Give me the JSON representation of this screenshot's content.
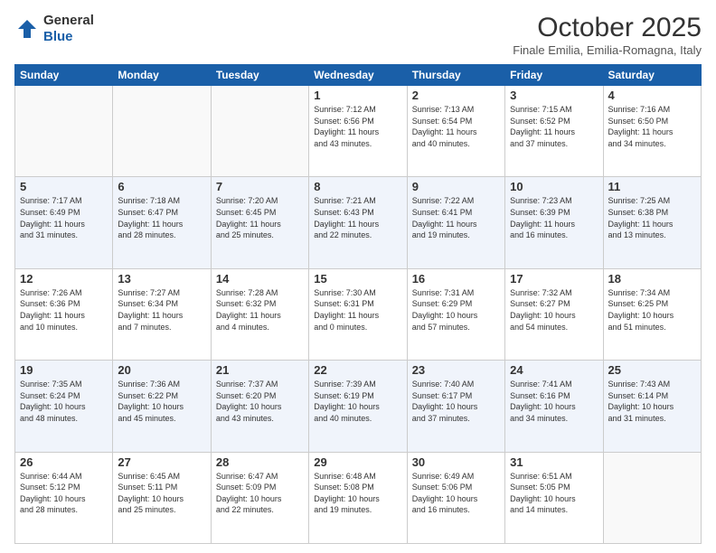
{
  "logo": {
    "general": "General",
    "blue": "Blue"
  },
  "header": {
    "title": "October 2025",
    "subtitle": "Finale Emilia, Emilia-Romagna, Italy"
  },
  "weekdays": [
    "Sunday",
    "Monday",
    "Tuesday",
    "Wednesday",
    "Thursday",
    "Friday",
    "Saturday"
  ],
  "weeks": [
    [
      {
        "day": "",
        "info": ""
      },
      {
        "day": "",
        "info": ""
      },
      {
        "day": "",
        "info": ""
      },
      {
        "day": "1",
        "info": "Sunrise: 7:12 AM\nSunset: 6:56 PM\nDaylight: 11 hours\nand 43 minutes."
      },
      {
        "day": "2",
        "info": "Sunrise: 7:13 AM\nSunset: 6:54 PM\nDaylight: 11 hours\nand 40 minutes."
      },
      {
        "day": "3",
        "info": "Sunrise: 7:15 AM\nSunset: 6:52 PM\nDaylight: 11 hours\nand 37 minutes."
      },
      {
        "day": "4",
        "info": "Sunrise: 7:16 AM\nSunset: 6:50 PM\nDaylight: 11 hours\nand 34 minutes."
      }
    ],
    [
      {
        "day": "5",
        "info": "Sunrise: 7:17 AM\nSunset: 6:49 PM\nDaylight: 11 hours\nand 31 minutes."
      },
      {
        "day": "6",
        "info": "Sunrise: 7:18 AM\nSunset: 6:47 PM\nDaylight: 11 hours\nand 28 minutes."
      },
      {
        "day": "7",
        "info": "Sunrise: 7:20 AM\nSunset: 6:45 PM\nDaylight: 11 hours\nand 25 minutes."
      },
      {
        "day": "8",
        "info": "Sunrise: 7:21 AM\nSunset: 6:43 PM\nDaylight: 11 hours\nand 22 minutes."
      },
      {
        "day": "9",
        "info": "Sunrise: 7:22 AM\nSunset: 6:41 PM\nDaylight: 11 hours\nand 19 minutes."
      },
      {
        "day": "10",
        "info": "Sunrise: 7:23 AM\nSunset: 6:39 PM\nDaylight: 11 hours\nand 16 minutes."
      },
      {
        "day": "11",
        "info": "Sunrise: 7:25 AM\nSunset: 6:38 PM\nDaylight: 11 hours\nand 13 minutes."
      }
    ],
    [
      {
        "day": "12",
        "info": "Sunrise: 7:26 AM\nSunset: 6:36 PM\nDaylight: 11 hours\nand 10 minutes."
      },
      {
        "day": "13",
        "info": "Sunrise: 7:27 AM\nSunset: 6:34 PM\nDaylight: 11 hours\nand 7 minutes."
      },
      {
        "day": "14",
        "info": "Sunrise: 7:28 AM\nSunset: 6:32 PM\nDaylight: 11 hours\nand 4 minutes."
      },
      {
        "day": "15",
        "info": "Sunrise: 7:30 AM\nSunset: 6:31 PM\nDaylight: 11 hours\nand 0 minutes."
      },
      {
        "day": "16",
        "info": "Sunrise: 7:31 AM\nSunset: 6:29 PM\nDaylight: 10 hours\nand 57 minutes."
      },
      {
        "day": "17",
        "info": "Sunrise: 7:32 AM\nSunset: 6:27 PM\nDaylight: 10 hours\nand 54 minutes."
      },
      {
        "day": "18",
        "info": "Sunrise: 7:34 AM\nSunset: 6:25 PM\nDaylight: 10 hours\nand 51 minutes."
      }
    ],
    [
      {
        "day": "19",
        "info": "Sunrise: 7:35 AM\nSunset: 6:24 PM\nDaylight: 10 hours\nand 48 minutes."
      },
      {
        "day": "20",
        "info": "Sunrise: 7:36 AM\nSunset: 6:22 PM\nDaylight: 10 hours\nand 45 minutes."
      },
      {
        "day": "21",
        "info": "Sunrise: 7:37 AM\nSunset: 6:20 PM\nDaylight: 10 hours\nand 43 minutes."
      },
      {
        "day": "22",
        "info": "Sunrise: 7:39 AM\nSunset: 6:19 PM\nDaylight: 10 hours\nand 40 minutes."
      },
      {
        "day": "23",
        "info": "Sunrise: 7:40 AM\nSunset: 6:17 PM\nDaylight: 10 hours\nand 37 minutes."
      },
      {
        "day": "24",
        "info": "Sunrise: 7:41 AM\nSunset: 6:16 PM\nDaylight: 10 hours\nand 34 minutes."
      },
      {
        "day": "25",
        "info": "Sunrise: 7:43 AM\nSunset: 6:14 PM\nDaylight: 10 hours\nand 31 minutes."
      }
    ],
    [
      {
        "day": "26",
        "info": "Sunrise: 6:44 AM\nSunset: 5:12 PM\nDaylight: 10 hours\nand 28 minutes."
      },
      {
        "day": "27",
        "info": "Sunrise: 6:45 AM\nSunset: 5:11 PM\nDaylight: 10 hours\nand 25 minutes."
      },
      {
        "day": "28",
        "info": "Sunrise: 6:47 AM\nSunset: 5:09 PM\nDaylight: 10 hours\nand 22 minutes."
      },
      {
        "day": "29",
        "info": "Sunrise: 6:48 AM\nSunset: 5:08 PM\nDaylight: 10 hours\nand 19 minutes."
      },
      {
        "day": "30",
        "info": "Sunrise: 6:49 AM\nSunset: 5:06 PM\nDaylight: 10 hours\nand 16 minutes."
      },
      {
        "day": "31",
        "info": "Sunrise: 6:51 AM\nSunset: 5:05 PM\nDaylight: 10 hours\nand 14 minutes."
      },
      {
        "day": "",
        "info": ""
      }
    ]
  ]
}
